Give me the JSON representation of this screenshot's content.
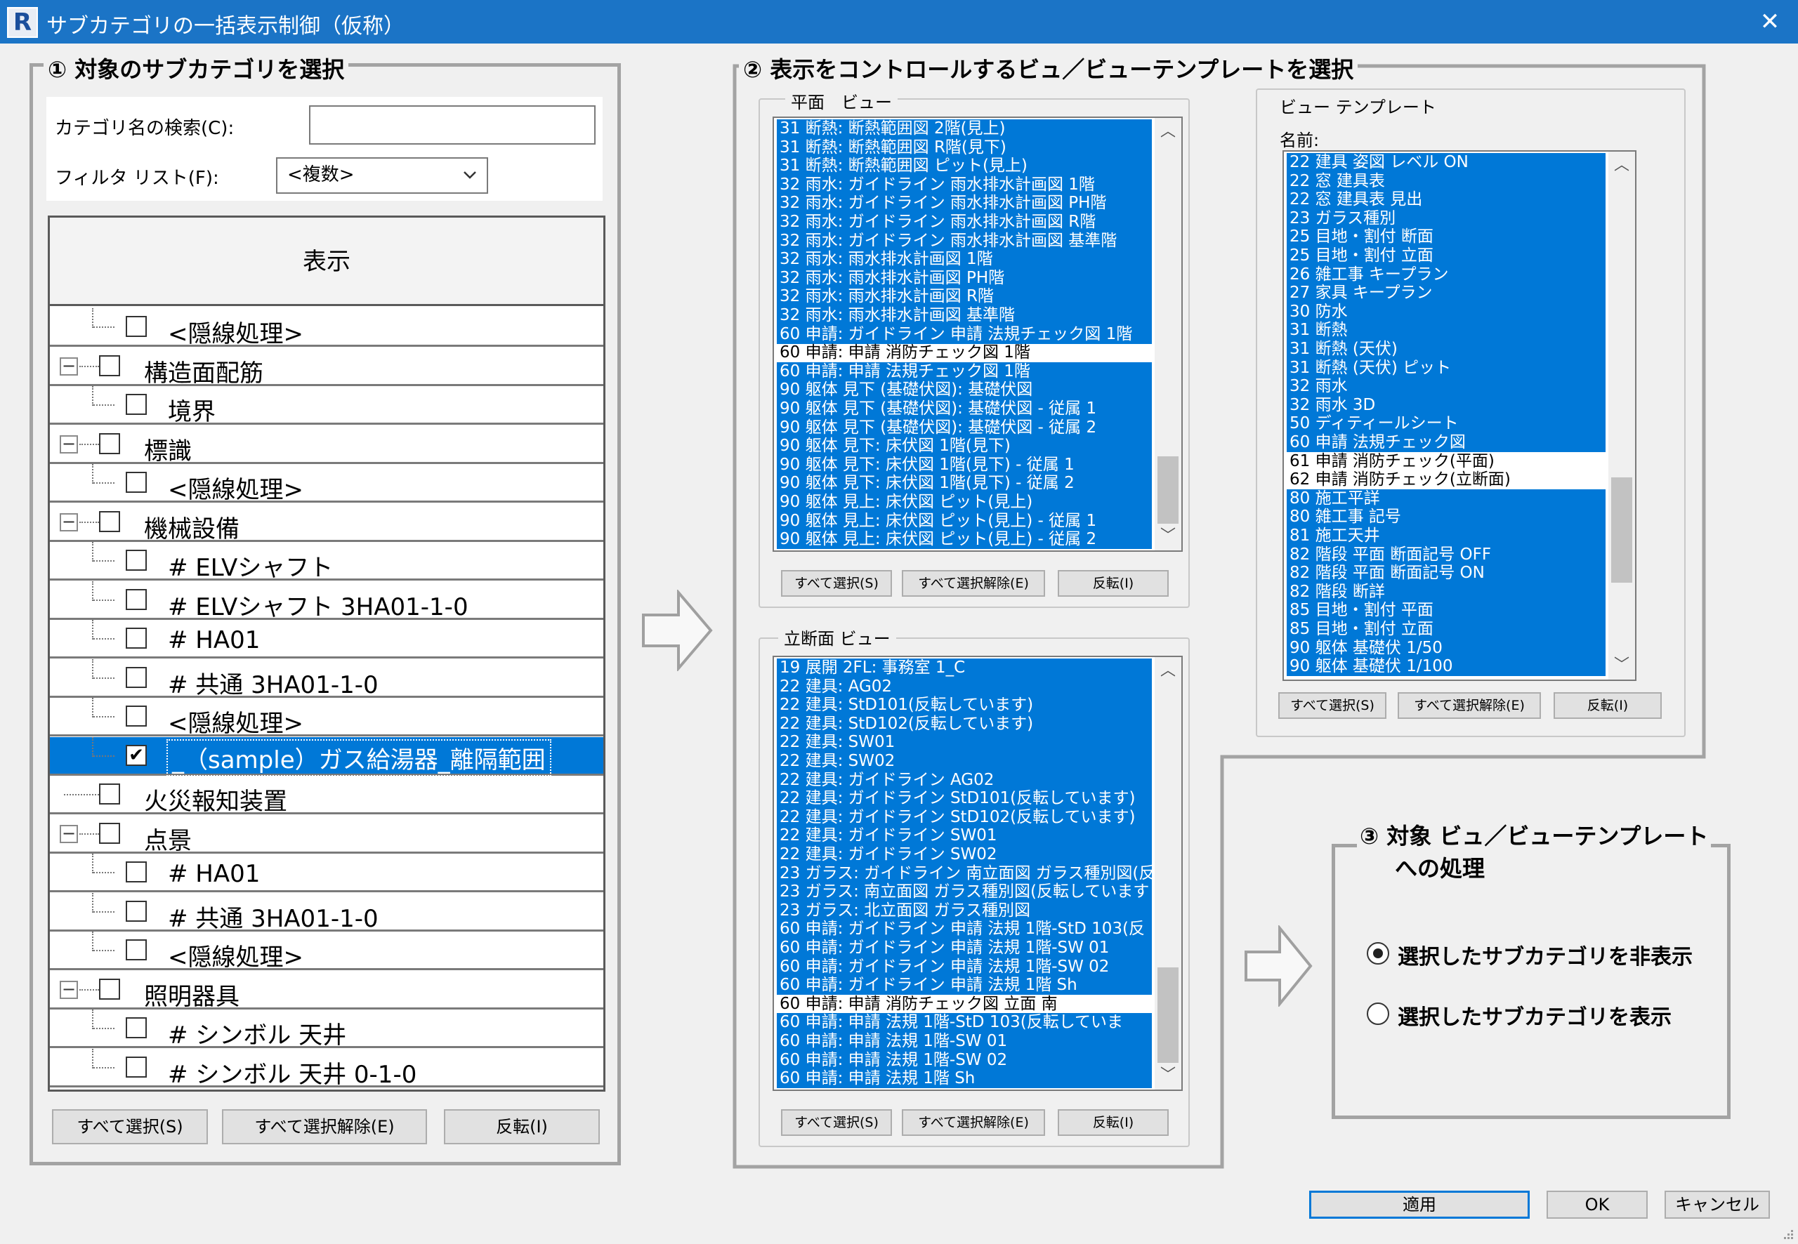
{
  "window": {
    "title": "サブカテゴリの一括表示制御（仮称）",
    "icon_letter": "R",
    "close_glyph": "✕"
  },
  "section1": {
    "title": "① 対象のサブカテゴリを選択",
    "search_label": "カテゴリ名の検索(C):",
    "search_value": "",
    "filter_label": "フィルタ リスト(F):",
    "filter_value": "<複数>",
    "column_header": "表示",
    "tree_rows": [
      {
        "label": "<隠線処理>",
        "level": 2,
        "checked": false,
        "expander": false,
        "selected": false
      },
      {
        "label": "構造面配筋",
        "level": 1,
        "checked": false,
        "expander": true,
        "selected": false
      },
      {
        "label": "境界",
        "level": 2,
        "checked": false,
        "expander": false,
        "selected": false
      },
      {
        "label": "標識",
        "level": 1,
        "checked": false,
        "expander": true,
        "selected": false
      },
      {
        "label": "<隠線処理>",
        "level": 2,
        "checked": false,
        "expander": false,
        "selected": false
      },
      {
        "label": "機械設備",
        "level": 1,
        "checked": false,
        "expander": true,
        "selected": false
      },
      {
        "label": "# ELVシャフト",
        "level": 2,
        "checked": false,
        "expander": false,
        "selected": false
      },
      {
        "label": "# ELVシャフト 3HA01-1-0",
        "level": 2,
        "checked": false,
        "expander": false,
        "selected": false
      },
      {
        "label": "# HA01",
        "level": 2,
        "checked": false,
        "expander": false,
        "selected": false
      },
      {
        "label": "# 共通 3HA01-1-0",
        "level": 2,
        "checked": false,
        "expander": false,
        "selected": false
      },
      {
        "label": "<隠線処理>",
        "level": 2,
        "checked": false,
        "expander": false,
        "selected": false
      },
      {
        "label": "_（sample）ガス給湯器_離隔範囲",
        "level": 2,
        "checked": true,
        "expander": false,
        "selected": true
      },
      {
        "label": "火災報知装置",
        "level": 1,
        "checked": false,
        "expander": false,
        "selected": false
      },
      {
        "label": "点景",
        "level": 1,
        "checked": false,
        "expander": true,
        "selected": false
      },
      {
        "label": "# HA01",
        "level": 2,
        "checked": false,
        "expander": false,
        "selected": false
      },
      {
        "label": "# 共通 3HA01-1-0",
        "level": 2,
        "checked": false,
        "expander": false,
        "selected": false
      },
      {
        "label": "<隠線処理>",
        "level": 2,
        "checked": false,
        "expander": false,
        "selected": false
      },
      {
        "label": "照明器具",
        "level": 1,
        "checked": false,
        "expander": true,
        "selected": false
      },
      {
        "label": "# シンボル 天井",
        "level": 2,
        "checked": false,
        "expander": false,
        "selected": false
      },
      {
        "label": "# シンボル 天井 0-1-0",
        "level": 2,
        "checked": false,
        "expander": false,
        "selected": false
      }
    ],
    "buttons": {
      "select_all": "すべて選択(S)",
      "deselect_all": "すべて選択解除(E)",
      "invert": "反転(I)"
    }
  },
  "section2": {
    "title": "② 表示をコントロールするビュ／ビューテンプレートを選択",
    "plan_views": {
      "title": "平面　ビュー",
      "items": [
        {
          "label": "31 断熱: 断熱範囲図 2階(見上)",
          "selected": true
        },
        {
          "label": "31 断熱: 断熱範囲図 R階(見下)",
          "selected": true
        },
        {
          "label": "31 断熱: 断熱範囲図 ピット(見上)",
          "selected": true
        },
        {
          "label": "32 雨水: ガイドライン 雨水排水計画図 1階",
          "selected": true
        },
        {
          "label": "32 雨水: ガイドライン 雨水排水計画図 PH階",
          "selected": true
        },
        {
          "label": "32 雨水: ガイドライン 雨水排水計画図 R階",
          "selected": true
        },
        {
          "label": "32 雨水: ガイドライン 雨水排水計画図 基準階",
          "selected": true
        },
        {
          "label": "32 雨水: 雨水排水計画図 1階",
          "selected": true
        },
        {
          "label": "32 雨水: 雨水排水計画図 PH階",
          "selected": true
        },
        {
          "label": "32 雨水: 雨水排水計画図 R階",
          "selected": true
        },
        {
          "label": "32 雨水: 雨水排水計画図 基準階",
          "selected": true
        },
        {
          "label": "60 申請: ガイドライン 申請 法規チェック図 1階",
          "selected": true
        },
        {
          "label": "60 申請: 申請 消防チェック図 1階",
          "selected": false
        },
        {
          "label": "60 申請: 申請 法規チェック図 1階",
          "selected": true
        },
        {
          "label": "90 躯体 見下 (基礎伏図): 基礎伏図",
          "selected": true
        },
        {
          "label": "90 躯体 見下 (基礎伏図): 基礎伏図 - 従属 1",
          "selected": true
        },
        {
          "label": "90 躯体 見下 (基礎伏図): 基礎伏図 - 従属 2",
          "selected": true
        },
        {
          "label": "90 躯体 見下: 床伏図 1階(見下)",
          "selected": true
        },
        {
          "label": "90 躯体 見下: 床伏図 1階(見下) - 従属 1",
          "selected": true
        },
        {
          "label": "90 躯体 見下: 床伏図 1階(見下) - 従属 2",
          "selected": true
        },
        {
          "label": "90 躯体 見上: 床伏図 ピット(見上)",
          "selected": true
        },
        {
          "label": "90 躯体 見上: 床伏図 ピット(見上) - 従属 1",
          "selected": true
        },
        {
          "label": "90 躯体 見上: 床伏図 ピット(見上) - 従属 2",
          "selected": true
        }
      ],
      "scroll_position": 0.8
    },
    "elevation_views": {
      "title": "立断面 ビュー",
      "items": [
        {
          "label": "19 展開 2FL: 事務室 1_C",
          "selected": true
        },
        {
          "label": "22 建具: AG02",
          "selected": true
        },
        {
          "label": "22 建具: StD101(反転しています)",
          "selected": true
        },
        {
          "label": "22 建具: StD102(反転しています)",
          "selected": true
        },
        {
          "label": "22 建具: SW01",
          "selected": true
        },
        {
          "label": "22 建具: SW02",
          "selected": true
        },
        {
          "label": "22 建具: ガイドライン AG02",
          "selected": true
        },
        {
          "label": "22 建具: ガイドライン StD101(反転しています)",
          "selected": true
        },
        {
          "label": "22 建具: ガイドライン StD102(反転しています)",
          "selected": true
        },
        {
          "label": "22 建具: ガイドライン SW01",
          "selected": true
        },
        {
          "label": "22 建具: ガイドライン SW02",
          "selected": true
        },
        {
          "label": "23 ガラス: ガイドライン 南立面図 ガラス種別図(反",
          "selected": true
        },
        {
          "label": "23 ガラス: 南立面図 ガラス種別図(反転しています",
          "selected": true
        },
        {
          "label": "23 ガラス: 北立面図 ガラス種別図",
          "selected": true
        },
        {
          "label": "60 申請: ガイドライン 申請 法規 1階-StD 103(反",
          "selected": true
        },
        {
          "label": "60 申請: ガイドライン 申請 法規 1階-SW 01",
          "selected": true
        },
        {
          "label": "60 申請: ガイドライン 申請 法規 1階-SW 02",
          "selected": true
        },
        {
          "label": "60 申請: ガイドライン 申請 法規 1階 Sh",
          "selected": true
        },
        {
          "label": "60 申請: 申請 消防チェック図 立面 南",
          "selected": false
        },
        {
          "label": "60 申請: 申請 法規 1階-StD 103(反転していま",
          "selected": true
        },
        {
          "label": "60 申請: 申請 法規 1階-SW 01",
          "selected": true
        },
        {
          "label": "60 申請: 申請 法規 1階-SW 02",
          "selected": true
        },
        {
          "label": "60 申請: 申請 法規 1階 Sh",
          "selected": true
        }
      ],
      "scroll_position": 0.85
    },
    "view_templates": {
      "title": "ビュー テンプレート",
      "name_label": "名前:",
      "items": [
        {
          "label": "22 建具 姿図 レベル ON",
          "selected": true
        },
        {
          "label": "22 窓 建具表",
          "selected": true
        },
        {
          "label": "22 窓 建具表 見出",
          "selected": true
        },
        {
          "label": "23 ガラス種別",
          "selected": true
        },
        {
          "label": "25 目地・割付 断面",
          "selected": true
        },
        {
          "label": "25 目地・割付 立面",
          "selected": true
        },
        {
          "label": "26 雑工事 キープラン",
          "selected": true
        },
        {
          "label": "27 家具 キープラン",
          "selected": true
        },
        {
          "label": "30 防水",
          "selected": true
        },
        {
          "label": "31 断熱",
          "selected": true
        },
        {
          "label": "31 断熱 (天伏)",
          "selected": true
        },
        {
          "label": "31 断熱 (天伏) ピット",
          "selected": true
        },
        {
          "label": "32 雨水",
          "selected": true
        },
        {
          "label": "32 雨水 3D",
          "selected": true
        },
        {
          "label": "50 ディティールシート",
          "selected": true
        },
        {
          "label": "60 申請 法規チェック図",
          "selected": true
        },
        {
          "label": "61 申請 消防チェック(平面)",
          "selected": false
        },
        {
          "label": "62 申請 消防チェック(立断面)",
          "selected": false
        },
        {
          "label": "80 施工平詳",
          "selected": true
        },
        {
          "label": "80 雑工事 記号",
          "selected": true
        },
        {
          "label": "81 施工天井",
          "selected": true
        },
        {
          "label": "82 階段 平面 断面記号 OFF",
          "selected": true
        },
        {
          "label": "82 階段 平面 断面記号 ON",
          "selected": true
        },
        {
          "label": "82 階段 断詳",
          "selected": true
        },
        {
          "label": "85 目地・割付 平面",
          "selected": true
        },
        {
          "label": "85 目地・割付 立面",
          "selected": true
        },
        {
          "label": "90 躯体 基礎伏 1/50",
          "selected": true
        },
        {
          "label": "90 躯体 基礎伏 1/100",
          "selected": true
        }
      ],
      "scroll_position": 0.55
    },
    "buttons": {
      "select_all": "すべて選択(S)",
      "deselect_all": "すべて選択解除(E)",
      "invert": "反転(I)"
    }
  },
  "section3": {
    "title_line1": "③ 対象 ビュ／ビューテンプレート",
    "title_line2": "への処理",
    "options": [
      {
        "label": "選択したサブカテゴリを非表示",
        "checked": true
      },
      {
        "label": "選択したサブカテゴリを表示",
        "checked": false
      }
    ]
  },
  "footer": {
    "apply": "適用",
    "ok": "OK",
    "cancel": "キャンセル"
  },
  "colors": {
    "titlebar": "#1b74c6",
    "selection": "#0078d7",
    "frame": "#a3a3a3",
    "background": "#f0f0f0"
  }
}
